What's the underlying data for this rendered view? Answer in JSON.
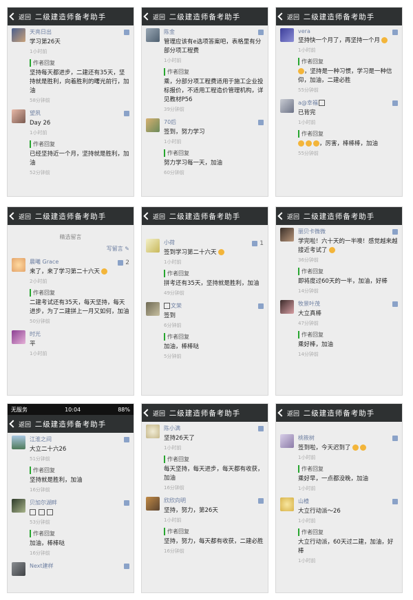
{
  "app": {
    "back_label": "返回",
    "title": "二级建造师备考助手"
  },
  "reply_header": "作者回复",
  "statusbar": {
    "carrier": "无服务",
    "time": "10:04",
    "battery": "88%"
  },
  "p1": {
    "c1": {
      "name": "天亮日出",
      "text": "学习第26天",
      "time": "1小时前"
    },
    "r1": {
      "text": "坚持每天都进步，二建还有35天，坚持就是胜利，向着胜利的曙光前行，加油",
      "time": "58分钟前"
    },
    "c2": {
      "name": "望夙",
      "text": "Day 26",
      "time": "1小时前"
    },
    "r2": {
      "text": "已经坚持近一个月，坚持就是胜利，加油",
      "time": "52分钟前"
    }
  },
  "p2": {
    "c1": {
      "name": "陈金",
      "text": "管理应该有e选项答案吧，表格里有分部分项工程费",
      "time": "1小时前"
    },
    "r1": {
      "text": "乘，分部分项工程费适用于施工企业投标报价，不适用工程造价管理机构，详见教材P56",
      "time": "39分钟前"
    },
    "c2": {
      "name": "70后",
      "text": "签到，努力学习",
      "time": "1小时前"
    },
    "r2": {
      "text": "努力学习每一天，加油",
      "time": "60分钟前"
    }
  },
  "p3": {
    "c1": {
      "name": "vera",
      "text": "坚持快一个月了，再坚持一个月",
      "time": "1小时前"
    },
    "r1": {
      "text": "，坚持是一种习惯，学习是一种信仰，加油，二建必胜",
      "time": "55分钟前"
    },
    "c2": {
      "name": "a@幸福",
      "text": "已背完",
      "time": "1小时前"
    },
    "r2": {
      "text": "，厉害，棒棒棒，加油",
      "time": "55分钟前"
    }
  },
  "p4": {
    "selected_label": "精选留言",
    "write_label": "写留言",
    "c1": {
      "name": "晨曦 Grace",
      "text": "来了，来了学习第二十六天",
      "time": "2小时前",
      "likes": "2"
    },
    "r1": {
      "text": "二建考试还有35天，每天坚持，每天进步，为了二建拼上一月又如何，加油",
      "time": "50分钟前"
    },
    "c2": {
      "name": "时光",
      "text": "平",
      "time": "1小时前"
    }
  },
  "p5": {
    "c1": {
      "name": "小荷",
      "text": "签到学习第二十六天",
      "time": "1小时前",
      "likes": "1"
    },
    "r1": {
      "text": "拼考还有35天，坚持就是胜利，加油",
      "time": "49分钟前"
    },
    "c2": {
      "name": "文荣",
      "text": "签到",
      "time": "6分钟前"
    },
    "r2": {
      "text": "加油，棒棒哒",
      "time": "5分钟前"
    }
  },
  "p6": {
    "c1": {
      "name": "丽贝卡微微",
      "text": "学完啦！六十天的一半噢！感觉越来越接近考试了",
      "time": "36分钟前"
    },
    "r1": {
      "text": "即将度过60天的一半，加油，好棒",
      "time": "14分钟前"
    },
    "c2": {
      "name": "牧景叶茂",
      "text": "大立真棒",
      "time": "47分钟前"
    },
    "r2": {
      "text": "乘好棒，加油",
      "time": "14分钟前"
    }
  },
  "p7": {
    "c1": {
      "name": "江淮之间",
      "text": "大立二十六26",
      "time": "51分钟前"
    },
    "r1": {
      "text": "坚持就是胜利，加油",
      "time": "16分钟前"
    },
    "c2": {
      "name": "贝加尔湖畔",
      "text": "",
      "time": "53分钟前"
    },
    "r2": {
      "text": "加油，棒棒哒",
      "time": "16分钟前"
    },
    "c3": {
      "name": "Next建样"
    }
  },
  "p8": {
    "c1": {
      "name": "陈小满",
      "text": "坚持26天了",
      "time": "1小时前"
    },
    "r1": {
      "text": "每天坚持，每天进步，每天都有收获，加油",
      "time": "16分钟前"
    },
    "c2": {
      "name": "欣欣向明",
      "text": "坚持，努力，第26天",
      "time": "1小时前"
    },
    "r2": {
      "text": "坚持，努力，每天都有收获，二建必胜",
      "time": "16分钟前"
    }
  },
  "p9": {
    "c1": {
      "name": "桃筱树",
      "text": "签到啦，今天迟到了",
      "time": "1小时前"
    },
    "r1": {
      "text": "乘好早，一点都没晚，加油",
      "time": "1小时前"
    },
    "c2": {
      "name": "山楂",
      "text": "大立行动派～26",
      "time": "1小时前"
    },
    "r2": {
      "text": "大立行动派，60天过二建，加油，好棒",
      "time": "1小时前"
    }
  },
  "colors": {
    "nav_bg": "#2e3132",
    "panel_bg": "#ededed",
    "name": "#6b7da0",
    "reply_bar": "#26a52e"
  }
}
